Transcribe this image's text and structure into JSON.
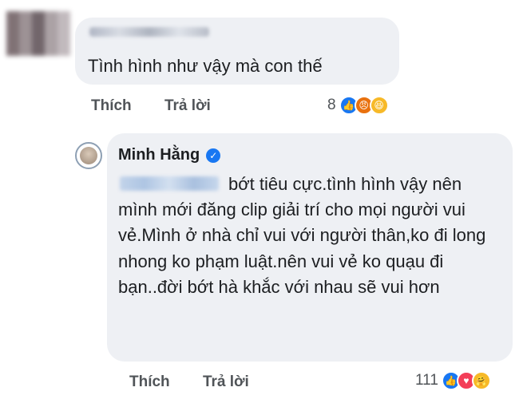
{
  "comment1": {
    "text": "Tình hình như vậy mà con thế",
    "actions": {
      "like": "Thích",
      "reply": "Trả lời"
    },
    "reaction_count": "8"
  },
  "comment2": {
    "author": "Minh Hằng",
    "text": "bớt tiêu cực.tình hình vậy nên mình mới đăng clip giải trí cho mọi người vui vẻ.Mình ở nhà chỉ vui với người thân,ko đi long nhong ko phạm luật.nên vui vẻ ko quạu đi bạn..đời bớt hà khắc với nhau sẽ vui hơn",
    "actions": {
      "like": "Thích",
      "reply": "Trả lời"
    },
    "reaction_count": "111"
  },
  "colors": {
    "bubble": "#eef0f4",
    "like_blue": "#1877f2",
    "angry_orange": "#e9710f",
    "haha_yellow": "#f7b928",
    "love_red": "#f33e58"
  },
  "icons": [
    "like-icon",
    "angry-icon",
    "haha-icon",
    "love-icon",
    "care-icon",
    "verified-badge-icon"
  ]
}
